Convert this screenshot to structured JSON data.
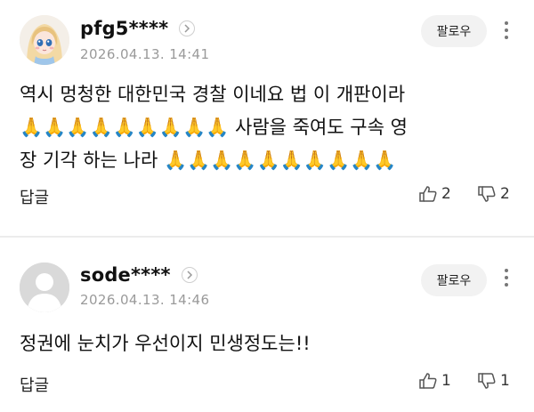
{
  "comments": [
    {
      "nickname": "pfg5****",
      "timestamp": "2026.04.13. 14:41",
      "follow_label": "팔로우",
      "lines": [
        "역시 멍청한 대한민국 경찰 이네요 법 이 개판이라",
        "🙏🙏🙏🙏🙏🙏🙏🙏🙏 사람을 죽여도 구속 영",
        "장 기각 하는 나라 🙏🙏🙏🙏🙏🙏🙏🙏🙏🙏"
      ],
      "reply_label": "답글",
      "likes": "2",
      "dislikes": "2"
    },
    {
      "nickname": "sode****",
      "timestamp": "2026.04.13. 14:46",
      "follow_label": "팔로우",
      "lines": [
        "정권에 눈치가 우선이지 민생정도는!!"
      ],
      "reply_label": "답글",
      "likes": "1",
      "dislikes": "1"
    }
  ],
  "icons": {
    "profile_arrow": "chevron-right-icon",
    "more": "more-vertical-icon",
    "like": "thumbs-up-icon",
    "dislike": "thumbs-down-icon"
  },
  "colors": {
    "timestamp": "#9a9a9a",
    "follow_bg": "#f2f2f2",
    "divider": "#ececec"
  }
}
